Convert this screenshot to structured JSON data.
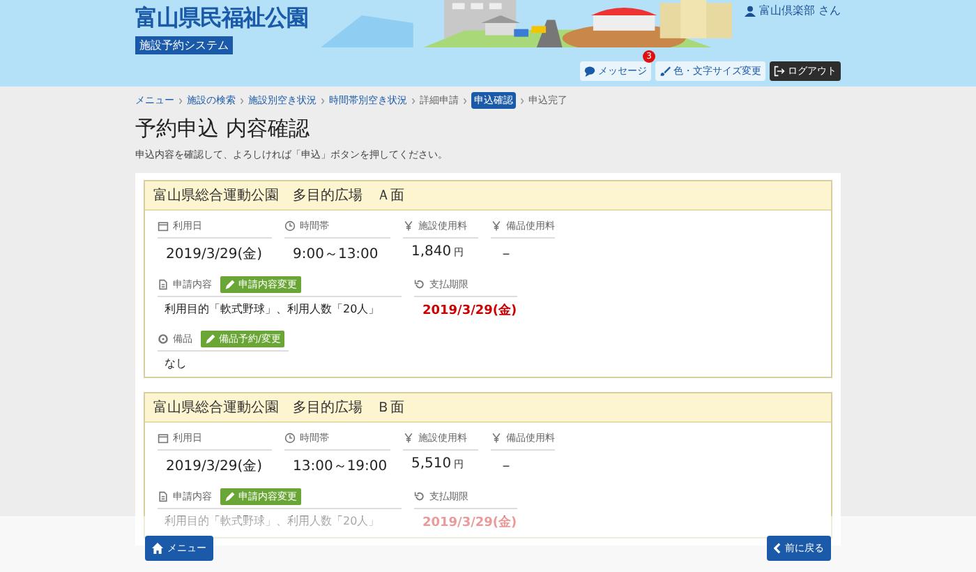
{
  "header": {
    "title": "富山県民福祉公園",
    "subtitle": "施設予約システム",
    "user": "富山倶楽部 さん",
    "buttons": [
      {
        "kind": "message",
        "label": "メッセージ",
        "badge": "3"
      },
      {
        "kind": "display",
        "label": "色・文字サイズ変更"
      },
      {
        "kind": "logout",
        "label": "ログアウト"
      }
    ]
  },
  "breadcrumb": [
    {
      "label": "メニュー",
      "kind": "link"
    },
    {
      "label": "施設の検索",
      "kind": "link"
    },
    {
      "label": "施設別空き状況",
      "kind": "link"
    },
    {
      "label": "時間帯別空き状況",
      "kind": "link"
    },
    {
      "label": "詳細申請",
      "kind": "text"
    },
    {
      "label": "申込確認",
      "kind": "current"
    },
    {
      "label": "申込完了",
      "kind": "text"
    }
  ],
  "page": {
    "title": "予約申込 内容確認",
    "description": "申込内容を確認して、よろしければ「申込」ボタンを押してください。"
  },
  "reservations": [
    {
      "title": "富山県総合運動公園　多目的広場　Ａ面",
      "date_label": "利用日",
      "date": "2019/3/29(金)",
      "time_label": "時間帯",
      "time": "9:00～13:00",
      "fee_label": "施設使用料",
      "fee": "1,840",
      "fee_unit": "円",
      "equip_fee_label": "備品使用料",
      "equip_fee": "－",
      "content_label": "申請内容",
      "content_button": "申請内容変更",
      "content": "利用目的「軟式野球」、利用人数「20人」",
      "deadline_label": "支払期限",
      "deadline": "2019/3/29(金)",
      "equipment_label": "備品",
      "equipment_button": "備品予約/変更",
      "equipment": "なし"
    },
    {
      "title": "富山県総合運動公園　多目的広場　Ｂ面",
      "date_label": "利用日",
      "date": "2019/3/29(金)",
      "time_label": "時間帯",
      "time": "13:00～19:00",
      "fee_label": "施設使用料",
      "fee": "5,510",
      "fee_unit": "円",
      "equip_fee_label": "備品使用料",
      "equip_fee": "－",
      "content_label": "申請内容",
      "content_button": "申請内容変更",
      "content": "利用目的「軟式野球」、利用人数「20人」",
      "deadline_label": "支払期限",
      "deadline": "2019/3/29(金)"
    }
  ],
  "footer": {
    "menu_button": "メニュー",
    "back_button": "前に戻る"
  }
}
